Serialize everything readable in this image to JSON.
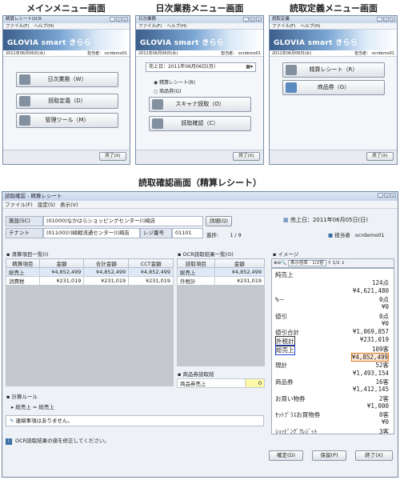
{
  "captions": {
    "main": "メインメニュー画面",
    "daily": "日次業務メニュー画面",
    "def": "読取定義メニュー画面",
    "confirm": "読取確認画面（精算レシート）"
  },
  "common": {
    "menu_file": "ファイル(F)",
    "menu_help": "ヘルプ(H)",
    "banner": "GLOVIA smart きらら",
    "date": "2011年06月06日(水)",
    "operator_label": "担当者：",
    "operator": "ocrdemo01",
    "end_btn": "終了(X)"
  },
  "main_win": {
    "title": "精算レシートOCR",
    "buttons": [
      "日次業務（W）",
      "読取定義（D）",
      "管理ツール（M）"
    ]
  },
  "daily_win": {
    "title": "日次業務",
    "sales_date_label": "売上日：",
    "sales_date": "2011年06月06日(月)",
    "radios": [
      "精算レシート(R)",
      "商品券(G)"
    ],
    "buttons": [
      "スキャナ読取（O）",
      "読取確認（C）"
    ]
  },
  "def_win": {
    "title": "読取定義",
    "buttons": [
      "精算レシート（R）",
      "商品券（G）"
    ]
  },
  "confirm_win": {
    "title": "読取確認 - 精算レシート",
    "menu": [
      "ファイル(F)",
      "設定(S)",
      "表示(V)"
    ],
    "facility_label": "施設(SC)",
    "facility": "(01000)なかはらショッピングセンター川崎店",
    "tenant_label": "テナント",
    "tenant": "(01100)川崎戦流通センター川崎店",
    "register_label": "レジ番号",
    "register": "01101",
    "detail_btn": "詳細(Q)",
    "progress_label": "進捗:",
    "progress": "1 / 9",
    "sales_date": "売上日：2011年06月05日(日)",
    "operator_label": "担当者",
    "operator": "ocrdemo01",
    "settle_title": "清算項目一覧(I)",
    "settle_cols": [
      "精算項目",
      "金額",
      "合計金額",
      "CCT金額"
    ],
    "settle_rows": [
      [
        "総売上",
        "¥4,852,499",
        "¥4,852,499",
        "¥4,852,499"
      ],
      [
        "消費税",
        "¥231,019",
        "¥231,019",
        "¥231,019"
      ]
    ],
    "ocr_title": "OCR読取結果一覧(O)",
    "ocr_cols": [
      "読取項目",
      "金額"
    ],
    "ocr_rows": [
      [
        "総売上",
        "¥4,852,499"
      ],
      [
        "外税計",
        "¥231,019"
      ]
    ],
    "goods_title": "商品券読取結",
    "goods_row": [
      "商品券売上",
      "0"
    ],
    "rule_title": "計算ルール",
    "rule": "総売上 = 総売上",
    "note": "連絡事項はありません。",
    "image_title": "イメージ",
    "img_toolbar": "表示倍率 - 1/2倍",
    "page": "1/2",
    "receipt": [
      [
        "純売上",
        ""
      ],
      [
        "",
        "124点"
      ],
      [
        "",
        "¥4,621,480"
      ],
      [
        "%－",
        "0点"
      ],
      [
        "",
        "¥0"
      ],
      [
        "値引",
        "0点"
      ],
      [
        "",
        "¥0"
      ],
      [
        "値引合計",
        "¥1,069,857"
      ],
      [
        "外税計",
        "¥231,019"
      ],
      [
        "総売上",
        "109客"
      ],
      [
        "",
        "¥4,852,499"
      ],
      [
        "現計",
        "52客"
      ],
      [
        "",
        "¥1,493,154"
      ],
      [
        "商品券",
        "16客"
      ],
      [
        "",
        "¥1,412,145"
      ],
      [
        "お買い物券",
        "2客"
      ],
      [
        "",
        "¥1,000"
      ],
      [
        "ｾｯﾄﾌﾟﾗｽお買物券",
        "0客"
      ],
      [
        "",
        "¥0"
      ],
      [
        "ｼｮｯﾋﾟﾝｸﾞｸﾚｼﾞｯﾄ",
        "3客"
      ]
    ],
    "status": "OCR読取結果の値を修正してください。",
    "btns": [
      "確定(D)",
      "保留(P)",
      "終了(X)"
    ]
  }
}
